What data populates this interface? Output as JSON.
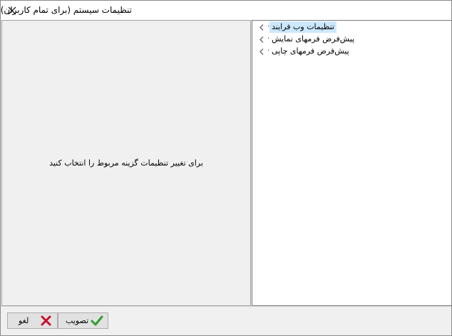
{
  "window": {
    "title": "تنظیمات سیستم (برای تمام کاربران)"
  },
  "tree": {
    "items": [
      {
        "label": "تنظیمات وب فرایند",
        "selected": true
      },
      {
        "label": "پیش‌فرض فرمهای نمایش",
        "selected": false
      },
      {
        "label": "پیش‌فرض فرمهای چاپی",
        "selected": false
      }
    ]
  },
  "detail": {
    "message": "برای تغییر تنظیمات گزینه مربوط را انتخاب کنید"
  },
  "buttons": {
    "cancel_label": "لغو",
    "ok_label": "تصویب"
  },
  "icons": {
    "close": "close-icon",
    "chevron": "chevron-left-icon",
    "cancel": "red-x-icon",
    "ok": "green-check-icon"
  },
  "colors": {
    "selection": "#cce8ff",
    "ok_check": "#2e9e2e",
    "cancel_x": "#c8102e"
  }
}
